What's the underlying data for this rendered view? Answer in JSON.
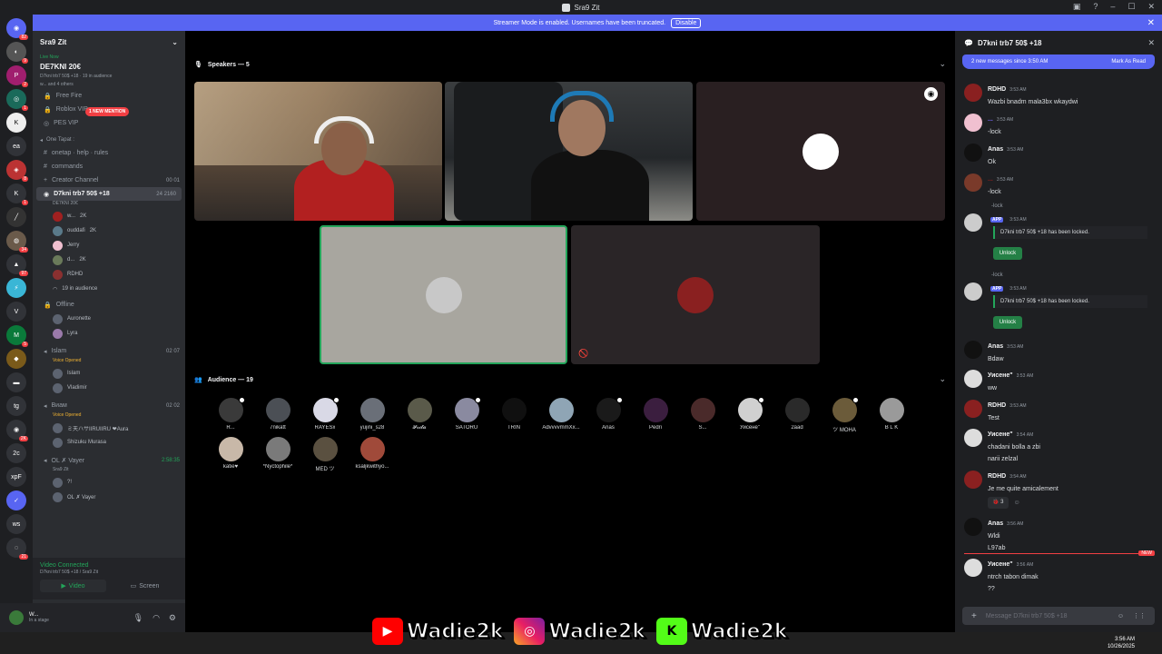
{
  "window": {
    "title": "Sra9 Zit"
  },
  "banner": {
    "text": "Streamer Mode is enabled. Usernames have been truncated.",
    "disable": "Disable"
  },
  "server": {
    "name": "Sra9 Zit"
  },
  "live": {
    "label": "Live Now",
    "channel": "DE7KNI 20€",
    "sub": "D7kni trb7 50$ +18 · 19 in audience",
    "others": "w... and 4 others"
  },
  "mention": "1 NEW MENTION",
  "channels_top": [
    {
      "label": "Free Fire"
    },
    {
      "label": "Roblox VIP"
    },
    {
      "label": "PES VIP"
    }
  ],
  "category_one": "One Tapat :",
  "channels_mid": [
    {
      "label": "onetap · help · rules"
    },
    {
      "label": "commands"
    },
    {
      "label": "Creator Channel",
      "right": "00 01"
    }
  ],
  "active_channel": {
    "label": "D7kni trb7 50$ +18",
    "right": "24 2160",
    "sub": "DE7KNI 20€"
  },
  "stage_members": [
    {
      "name": "w...",
      "badge": "2K"
    },
    {
      "name": "ouddafi",
      "badge": "2K"
    },
    {
      "name": "Jerry",
      "badge": ""
    },
    {
      "name": "d...",
      "badge": "2K"
    },
    {
      "name": "RDHD",
      "badge": ""
    }
  ],
  "in_audience": "19 in audience",
  "offline_cat": "Offline",
  "offline_members": [
    {
      "name": "Auronette"
    },
    {
      "name": "Lyra"
    }
  ],
  "islam": {
    "label": "Islam",
    "right": "02 07",
    "sub": "Voice Opened",
    "members": [
      {
        "name": "Islam"
      },
      {
        "name": "Vladimir"
      }
    ]
  },
  "bwam": {
    "label": "Виам",
    "right": "02 02",
    "sub": "Voice Opened",
    "members": [
      {
        "name": "ミ天ハサIIRUIIRU ❤Aura"
      },
      {
        "name": "Shizuku Murasa"
      }
    ]
  },
  "ol": {
    "label": "OL ✗ Vayer",
    "right": "2:58:35",
    "sub": "Sra9 Zit",
    "members": [
      {
        "name": "?!"
      },
      {
        "name": "OL ✗ Vayer"
      }
    ]
  },
  "voice": {
    "status": "Video Connected",
    "location": "D7kni trb7 50$ +18 / Sra9 Zit",
    "video": "Video",
    "screen": "Screen"
  },
  "user": {
    "name": "W...",
    "status": "In a stage"
  },
  "speakers_title": "Speakers — 5",
  "audience_title": "Audience — 19",
  "audience": [
    {
      "name": "R...",
      "color": "#3a3a3a"
    },
    {
      "name": "7nikatt",
      "color": "#4b4f55"
    },
    {
      "name": "RAYESx",
      "color": "#d9d9e6"
    },
    {
      "name": "yujini_s28",
      "color": "#6a6f78"
    },
    {
      "name": "𝓕𝓻𝓲𝓽𝓪",
      "color": "#5a5a4a"
    },
    {
      "name": "SATORU",
      "color": "#8a8aa0"
    },
    {
      "name": "TRIN",
      "color": "#101010"
    },
    {
      "name": "AdvvvvmmXx...",
      "color": "#8fa5b5"
    },
    {
      "name": "Anas",
      "color": "#1a1a1a"
    },
    {
      "name": "Pedri",
      "color": "#3b1e3f"
    },
    {
      "name": "S...",
      "color": "#4a2a2a"
    },
    {
      "name": "Уисене\"",
      "color": "#d0d0d0"
    },
    {
      "name": "2aad",
      "color": "#2a2a2a"
    },
    {
      "name": "ツ MOHA",
      "color": "#6b5b3a"
    },
    {
      "name": "B L K",
      "color": "#9a9a9a"
    },
    {
      "name": "katie♥",
      "color": "#c8b8a8"
    },
    {
      "name": "*Nyctophile*",
      "color": "#7a7a7a"
    },
    {
      "name": "MED ツ",
      "color": "#5a5040"
    },
    {
      "name": "ksaljkwithyo...",
      "color": "#a04a3a"
    }
  ],
  "chat": {
    "title": "D7kni trb7 50$ +18",
    "new_messages": "2 new messages since 3:50 AM",
    "mark_read": "Mark As Read",
    "placeholder": "Message D7kni trb7 50$ +18",
    "messages": [
      {
        "name": "RDHD",
        "time": "3:53 AM",
        "lines": [
          "Wazbi bnadm mala3bx wkaydwi"
        ]
      },
      {
        "name": "...",
        "time": "3:53 AM",
        "lines": [
          "-lock"
        ]
      },
      {
        "name": "Anas",
        "time": "3:53 AM",
        "lines": [
          "Ok"
        ]
      },
      {
        "name": "...",
        "time": "3:53 AM",
        "lines": [
          "-lock"
        ]
      }
    ],
    "lock1": {
      "reply": "-lock",
      "app": "APP",
      "time": "3:53 AM",
      "text": "D7kni trb7 50$ +18 has been locked.",
      "button": "Unlock"
    },
    "lock2": {
      "reply": "-lock",
      "app": "APP",
      "time": "3:53 AM",
      "text": "D7kni trb7 50$ +18 has been locked.",
      "button": "Unlock"
    },
    "later": [
      {
        "name": "Anas",
        "time": "3:53 AM",
        "lines": [
          "Bdaw"
        ]
      },
      {
        "name": "Уисене\"",
        "time": "3:53 AM",
        "lines": [
          "ww"
        ]
      },
      {
        "name": "RDHD",
        "time": "3:53 AM",
        "lines": [
          "Test"
        ]
      },
      {
        "name": "Уисене\"",
        "time": "3:54 AM",
        "lines": [
          "chadani bolla a zbi",
          "narii zelzal"
        ]
      },
      {
        "name": "RDHD",
        "time": "3:54 AM",
        "lines": [
          "Je me quite amicalement"
        ]
      },
      {
        "name": "Anas",
        "time": "3:56 AM",
        "lines": [
          "Wldi",
          "L97ab"
        ]
      },
      {
        "name": "Уисене\"",
        "time": "3:56 AM",
        "lines": [
          "ntrch tabon dimak",
          "??"
        ]
      }
    ],
    "reaction_count": "3",
    "new_label": "NEW"
  },
  "watermark": {
    "handle": "Wadie2k"
  },
  "clock": {
    "time": "3:56 AM",
    "date": "10/26/2025"
  }
}
